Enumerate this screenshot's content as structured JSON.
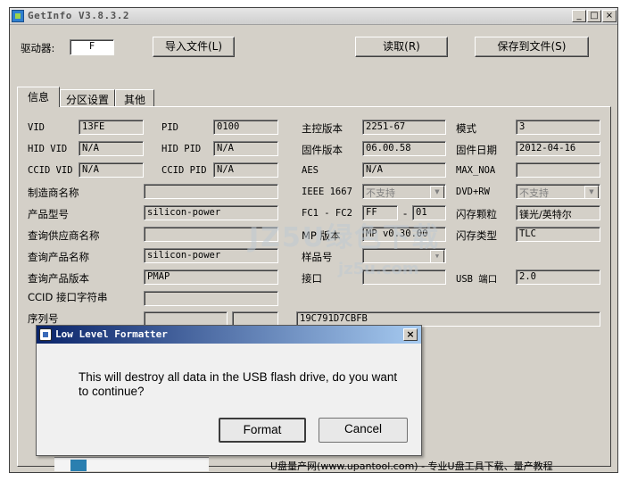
{
  "window": {
    "title": "GetInfo V3.8.3.2",
    "controls": {
      "minimize": "_",
      "maximize": "□",
      "close": "×"
    }
  },
  "toolbar": {
    "drive_label": "驱动器:",
    "drive_value": "F",
    "import_button": "导入文件(L)",
    "read_button": "读取(R)",
    "save_button": "保存到文件(S)"
  },
  "tabs": [
    {
      "label": "信息",
      "selected": true
    },
    {
      "label": "分区设置",
      "selected": false
    },
    {
      "label": "其他",
      "selected": false
    }
  ],
  "info": {
    "vid_label": "VID",
    "vid_value": "13FE",
    "pid_label": "PID",
    "pid_value": "0100",
    "controller_version_label": "主控版本",
    "controller_version_value": "2251-67",
    "mode_label": "模式",
    "mode_value": "3",
    "hid_vid_label": "HID VID",
    "hid_vid_value": "N/A",
    "hid_pid_label": "HID PID",
    "hid_pid_value": "N/A",
    "firmware_version_label": "固件版本",
    "firmware_version_value": "06.00.58",
    "firmware_date_label": "固件日期",
    "firmware_date_value": "2012-04-16",
    "ccid_vid_label": "CCID VID",
    "ccid_vid_value": "N/A",
    "ccid_pid_label": "CCID PID",
    "ccid_pid_value": "N/A",
    "aes_label": "AES",
    "aes_value": "N/A",
    "max_noa_label": "MAX_NOA",
    "max_noa_value": "",
    "manufacturer_label": "制造商名称",
    "manufacturer_value": "",
    "ieee1667_label": "IEEE 1667",
    "ieee1667_value": "不支持",
    "dvd_rw_label": "DVD+RW",
    "dvd_rw_value": "不支持",
    "product_model_label": "产品型号",
    "product_model_value": "silicon-power",
    "fc_label": "FC1 - FC2",
    "fc1_value": "FF",
    "fc_separator": "-",
    "fc2_value": "01",
    "flash_chip_label": "闪存颗粒",
    "flash_chip_value": "镁光/英特尔",
    "query_vendor_label": "查询供应商名称",
    "query_vendor_value": "",
    "mp_version_label": "MP 版本",
    "mp_version_value": "MP v0.30.00",
    "flash_type_label": "闪存类型",
    "flash_type_value": "TLC",
    "query_product_label": "查询产品名称",
    "query_product_value": "silicon-power",
    "sample_label": "样品号",
    "sample_value": "",
    "query_product_version_label": "查询产品版本",
    "query_product_version_value": "PMAP",
    "interface_label": "接口",
    "interface_value": "",
    "usb_port_label": "USB 端口",
    "usb_port_value": "2.0",
    "ccid_interface_label": "CCID 接口字符串",
    "ccid_interface_value": "",
    "serial_label": "序列号",
    "serial_value": "19C791D7CBFB"
  },
  "dialog": {
    "title": "Low Level Formatter",
    "close": "×",
    "message": "This will destroy all data in the USB flash drive, do you want to continue?",
    "format_button": "Format",
    "cancel_button": "Cancel"
  },
  "footer": {
    "text": "U盘量产网(www.upantool.com) - 专业U盘工具下载、量产教程"
  },
  "watermark": {
    "text": "JZ5U绿色下载",
    "sub": "jz5u.com"
  },
  "colors": {
    "window_bg": "#d4d0c8",
    "dialog_title": "#0a246a",
    "dialog_bg": "#f0f0f0"
  }
}
